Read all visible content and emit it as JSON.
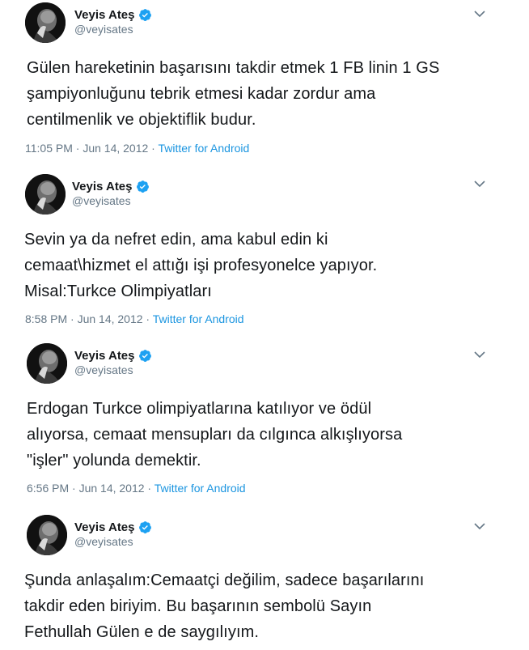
{
  "colors": {
    "text": "#14171a",
    "secondary": "#657786",
    "link": "#1b95e0",
    "verified": "#1da1f2"
  },
  "icons": {
    "verified": "verified-badge-icon",
    "caret": "chevron-down-icon"
  },
  "tweets": [
    {
      "name": "Veyis Ateş",
      "handle": "@veyisates",
      "text": "Gülen hareketinin başarısını takdir etmek 1 FB linin 1 GS\nşampiyonluğunu tebrik etmesi kadar zordur ama\ncentilmenlik ve objektiflik budur.",
      "time": "11:05 PM · Jun 14, 2012 · ",
      "source": "Twitter for Android"
    },
    {
      "name": "Veyis Ateş",
      "handle": "@veyisates",
      "text": "Sevin ya da nefret edin, ama kabul edin ki\ncemaat\\hizmet el attığı işi profesyonelce yapıyor.\nMisal:Turkce Olimpiyatları",
      "time": "8:58 PM · Jun 14, 2012 · ",
      "source": "Twitter for Android"
    },
    {
      "name": "Veyis Ateş",
      "handle": "@veyisates",
      "text": "Erdogan Turkce olimpiyatlarına katılıyor ve ödül\nalıyorsa, cemaat mensupları da cılgınca alkışlıyorsa\n\"işler\" yolunda demektir.",
      "time": "6:56 PM · Jun 14, 2012 · ",
      "source": "Twitter for Android"
    },
    {
      "name": "Veyis Ateş",
      "handle": "@veyisates",
      "text": "Şunda anlaşalım:Cemaatçi değilim, sadece başarılarını\ntakdir eden biriyim. Bu başarının sembolü Sayın\nFethullah Gülen e de saygılıyım."
    }
  ]
}
